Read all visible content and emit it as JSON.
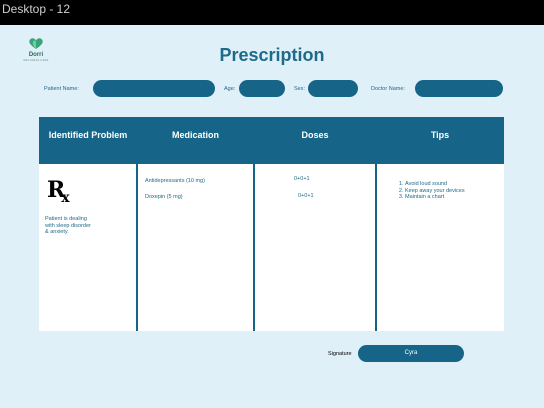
{
  "frame": {
    "title": "Desktop - 12"
  },
  "brand": {
    "name": "Dorri",
    "tagline": "WELLNESS CARE"
  },
  "page": {
    "title": "Prescription"
  },
  "form": {
    "patient_name_label": "Patient Name:",
    "age_label": "Age:",
    "sex_label": "Sex:",
    "doctor_name_label": "Doctor Name:"
  },
  "table": {
    "headers": [
      "Identified Problem",
      "Medication",
      "Doses",
      "Tips"
    ],
    "rx_symbol": "R",
    "rx_sub": "x",
    "problem": [
      "Patient is dealing",
      "with sleep disorder",
      "& anxiety."
    ],
    "medications": [
      "Antidepressants (10 mg)",
      "Doxepin (5 mg)"
    ],
    "doses": [
      "0+0+1",
      "0+0+1"
    ],
    "tips": [
      "Avoid loud sound",
      "Keep away your devices",
      "Maintain a chart"
    ]
  },
  "signature": {
    "label": "Signature",
    "value": "Cyra"
  },
  "colors": {
    "primary": "#166589",
    "background": "#dff0f8",
    "brand_green": "#2a6b4d"
  }
}
